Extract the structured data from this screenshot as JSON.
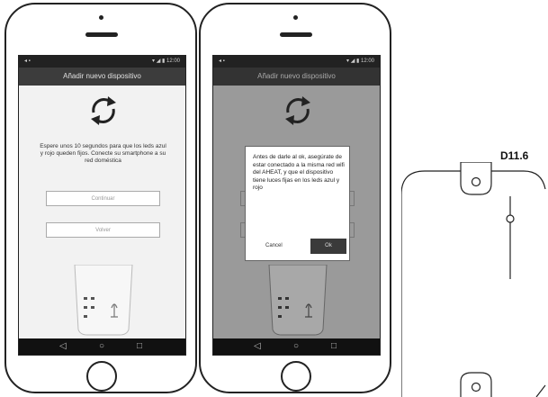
{
  "phones": [
    {
      "title": "Añadir nuevo dispositivo",
      "message": "Espere unos 10 segundos para que los leds azul y rojo queden fijos. Conecte su smartphone a su red doméstica",
      "buttons": [
        "Continuar",
        "Volver"
      ]
    },
    {
      "title": "Añadir nuevo dispositivo",
      "dialog": {
        "text": "Antes de darle al ok, asegúrate de estar conectado a la misma red wifi del AHEAT, y que el dispositivo tiene luces fijas en los leds azul y rojo",
        "cancel": "Cancel",
        "ok": "Ok"
      }
    }
  ],
  "detail": {
    "label": "D11.6"
  },
  "colors": {
    "screen_bg": "#f2f2f2",
    "dim_bg": "#9a9a9a",
    "titlebar": "#3c3c3c",
    "dark": "#222222"
  }
}
